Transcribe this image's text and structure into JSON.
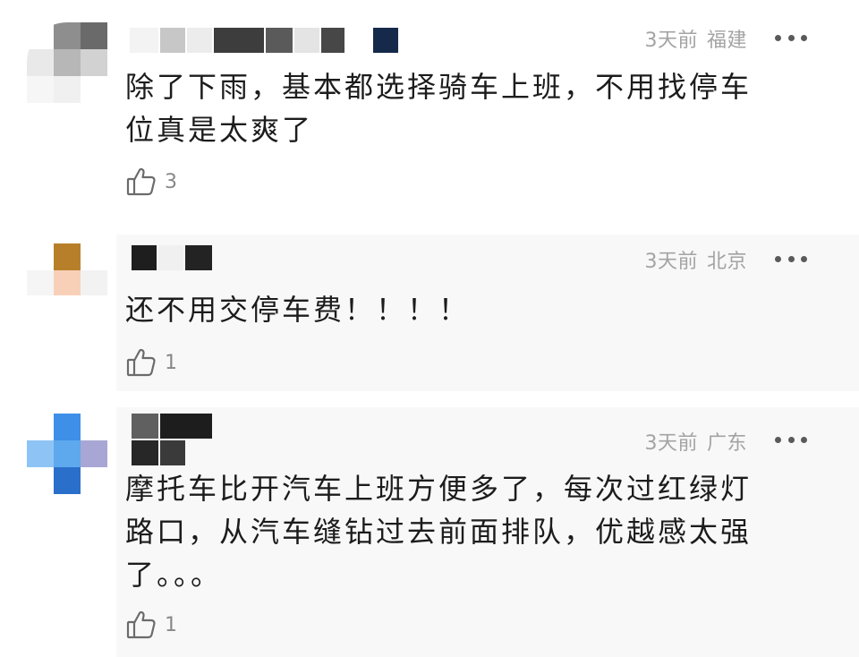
{
  "comments": [
    {
      "time": "3天前",
      "location": "福建",
      "text_lines": [
        "除了下雨，基本都选择骑车上班，不用找停车",
        "位真是太爽了"
      ],
      "likes": "3"
    },
    {
      "time": "3天前",
      "location": "北京",
      "text_lines": [
        "还不用交停车费！！！！"
      ],
      "likes": "1"
    },
    {
      "time": "3天前",
      "location": "广东",
      "text_lines": [
        "摩托车比开汽车上班方便多了，每次过红绿灯",
        "路口，从汽车缝钻过去前面排队，优越感太强",
        "了。。。"
      ],
      "likes": "1"
    }
  ],
  "icons": {
    "like": "thumbs-up-icon",
    "more": "more-dots-icon"
  },
  "colors": {
    "text": "#1c1c1c",
    "meta": "#a3a3a3",
    "like_count": "#888888"
  }
}
